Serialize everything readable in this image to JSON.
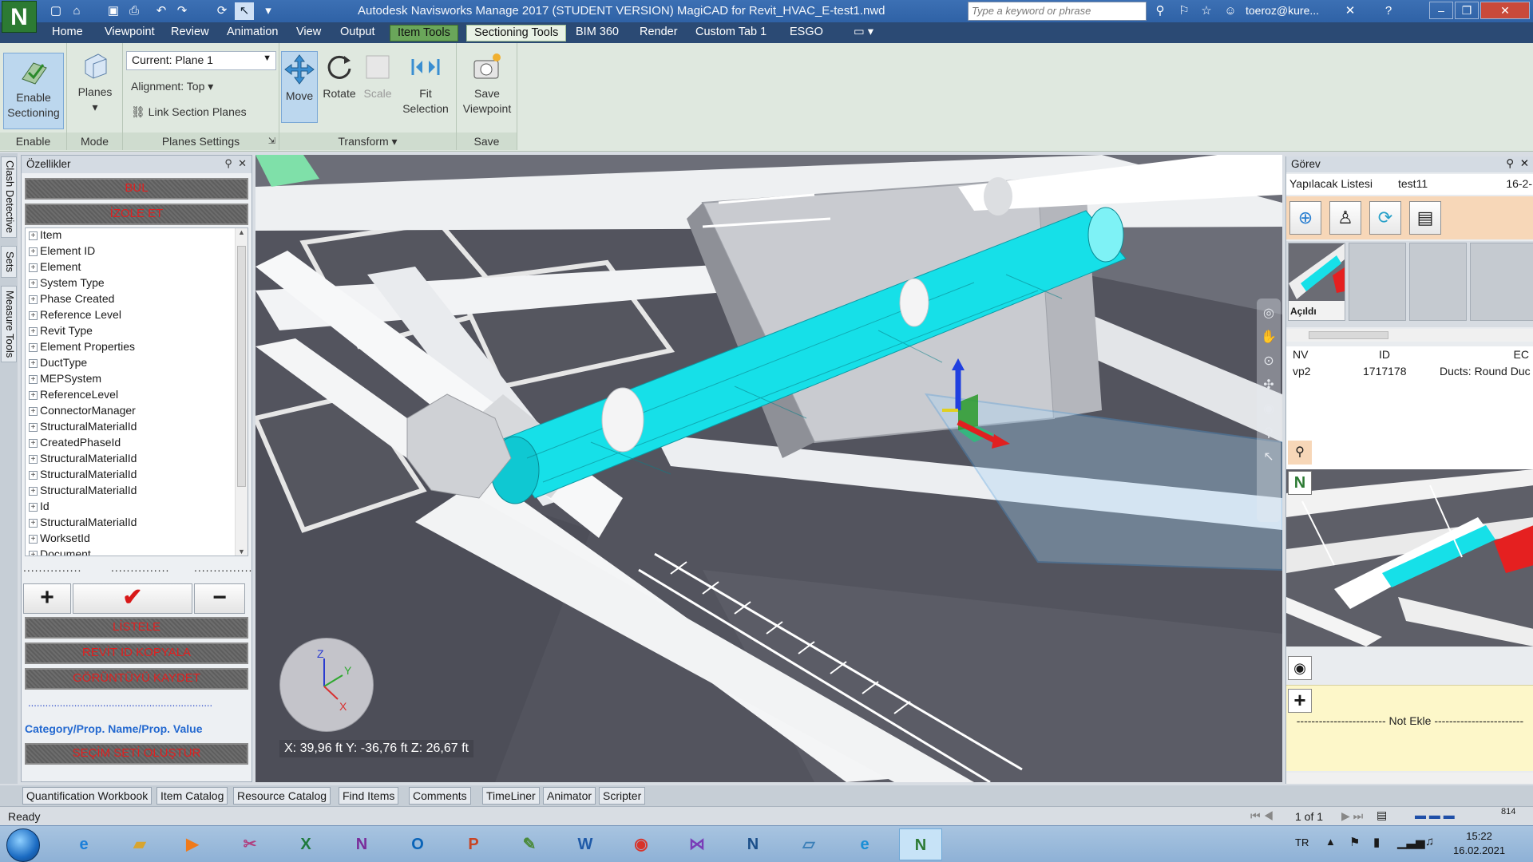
{
  "titlebar": {
    "app_logo": "N",
    "title": "Autodesk Navisworks Manage 2017 (STUDENT VERSION)     MagiCAD for Revit_HVAC_E-test1.nwd",
    "search_placeholder": "Type a keyword or phrase",
    "user": "toeroz@kure..."
  },
  "menu": {
    "tabs": [
      "Home",
      "Viewpoint",
      "Review",
      "Animation",
      "View",
      "Output",
      "Item Tools",
      "Sectioning Tools",
      "BIM 360",
      "Render",
      "Custom Tab 1",
      "ESGO"
    ]
  },
  "ribbon": {
    "enable_sectioning": "Enable Sectioning",
    "planes": "Planes",
    "plane_select": "Current: Plane 1",
    "alignment": "Alignment: Top",
    "link_section_planes": "Link Section Planes",
    "move": "Move",
    "rotate": "Rotate",
    "scale": "Scale",
    "fit_selection": "Fit Selection",
    "save_viewpoint": "Save Viewpoint",
    "groups": {
      "enable": "Enable",
      "mode": "Mode",
      "planes_settings": "Planes Settings",
      "transform": "Transform",
      "save": "Save"
    }
  },
  "sidetabs": [
    "Clash Detective",
    "Sets",
    "Measure Tools"
  ],
  "left_panel": {
    "title": "Özellikler",
    "bul": "BUL",
    "izole": "İZOLE ET",
    "tree_items": [
      "Item",
      "Element ID",
      "Element",
      "System Type",
      "Phase Created",
      "Reference Level",
      "Revit Type",
      "Element Properties",
      "DuctType",
      "MEPSystem",
      "ReferenceLevel",
      "ConnectorManager",
      "StructuralMaterialId",
      "CreatedPhaseId",
      "StructuralMaterialId",
      "StructuralMaterialId",
      "StructuralMaterialId",
      "Id",
      "StructuralMaterialId",
      "WorksetId",
      "Document"
    ],
    "listele": "LİSTELE",
    "revit_id": "REVİT ID  KOPYALA",
    "goruntu": "GÖRÜNTÜYÜ KAYDET",
    "category_label": "Category/Prop. Name/Prop. Value",
    "secim": "SEÇİM SETİ OLUŞTUR"
  },
  "viewport": {
    "coords": "X: 39,96 ft   Y: -36,76 ft   Z: 26,67 ft",
    "axis_x": "X",
    "axis_y": "Y",
    "axis_z": "Z"
  },
  "right_panel": {
    "title": "Görev",
    "todo_label": "Yapılacak Listesi",
    "todo_name": "test11",
    "todo_date": "16-2-",
    "thumb_caption": "Açıldı",
    "columns": [
      "NV",
      "ID",
      "EC"
    ],
    "row": [
      "vp2",
      "1717178",
      "Ducts: Round Duc"
    ],
    "note_label": "------------------------ Not Ekle ------------------------"
  },
  "bottom_tabs": [
    "Quantification Workbook",
    "Item Catalog",
    "Resource Catalog",
    "Find Items",
    "Comments",
    "TimeLiner",
    "Animator",
    "Scripter"
  ],
  "status": {
    "text": "Ready",
    "page": "1 of 1",
    "memory": "814"
  },
  "taskbar": {
    "lang": "TR",
    "time": "15:22",
    "date": "16.02.2021"
  },
  "colors": {
    "duct_selected": "#16e0e8",
    "ribbon_bg": "#dfe8df",
    "title_bg": "#2f62a6",
    "red_text": "#e02020"
  }
}
